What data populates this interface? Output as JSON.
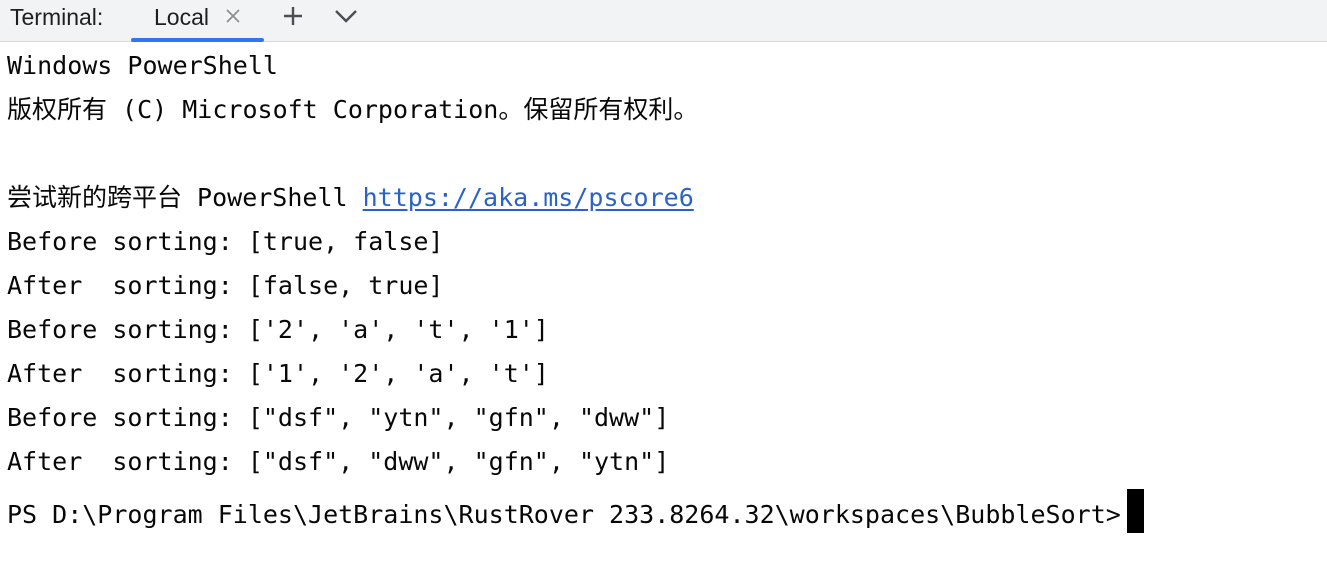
{
  "tabbar": {
    "title": "Terminal:",
    "tab_label": "Local",
    "close_icon": "close-icon",
    "add_icon": "plus-icon",
    "more_icon": "chevron-down-icon",
    "accent": "#3574f0"
  },
  "terminal": {
    "lines": [
      "Windows PowerShell",
      "版权所有 (C) Microsoft Corporation。保留所有权利。",
      "",
      "尝试新的跨平台 PowerShell ",
      "Before sorting: [true, false]",
      "After  sorting: [false, true]",
      "Before sorting: ['2', 'a', 't', '1']",
      "After  sorting: ['1', '2', 'a', 't']",
      "Before sorting: [\"dsf\", \"ytn\", \"gfn\", \"dww\"]",
      "After  sorting: [\"dsf\", \"dww\", \"gfn\", \"ytn\"]"
    ],
    "link": "https://aka.ms/pscore6",
    "prompt": "PS D:\\Program Files\\JetBrains\\RustRover 233.8264.32\\workspaces\\BubbleSort>",
    "link_color": "#2a63c7"
  }
}
